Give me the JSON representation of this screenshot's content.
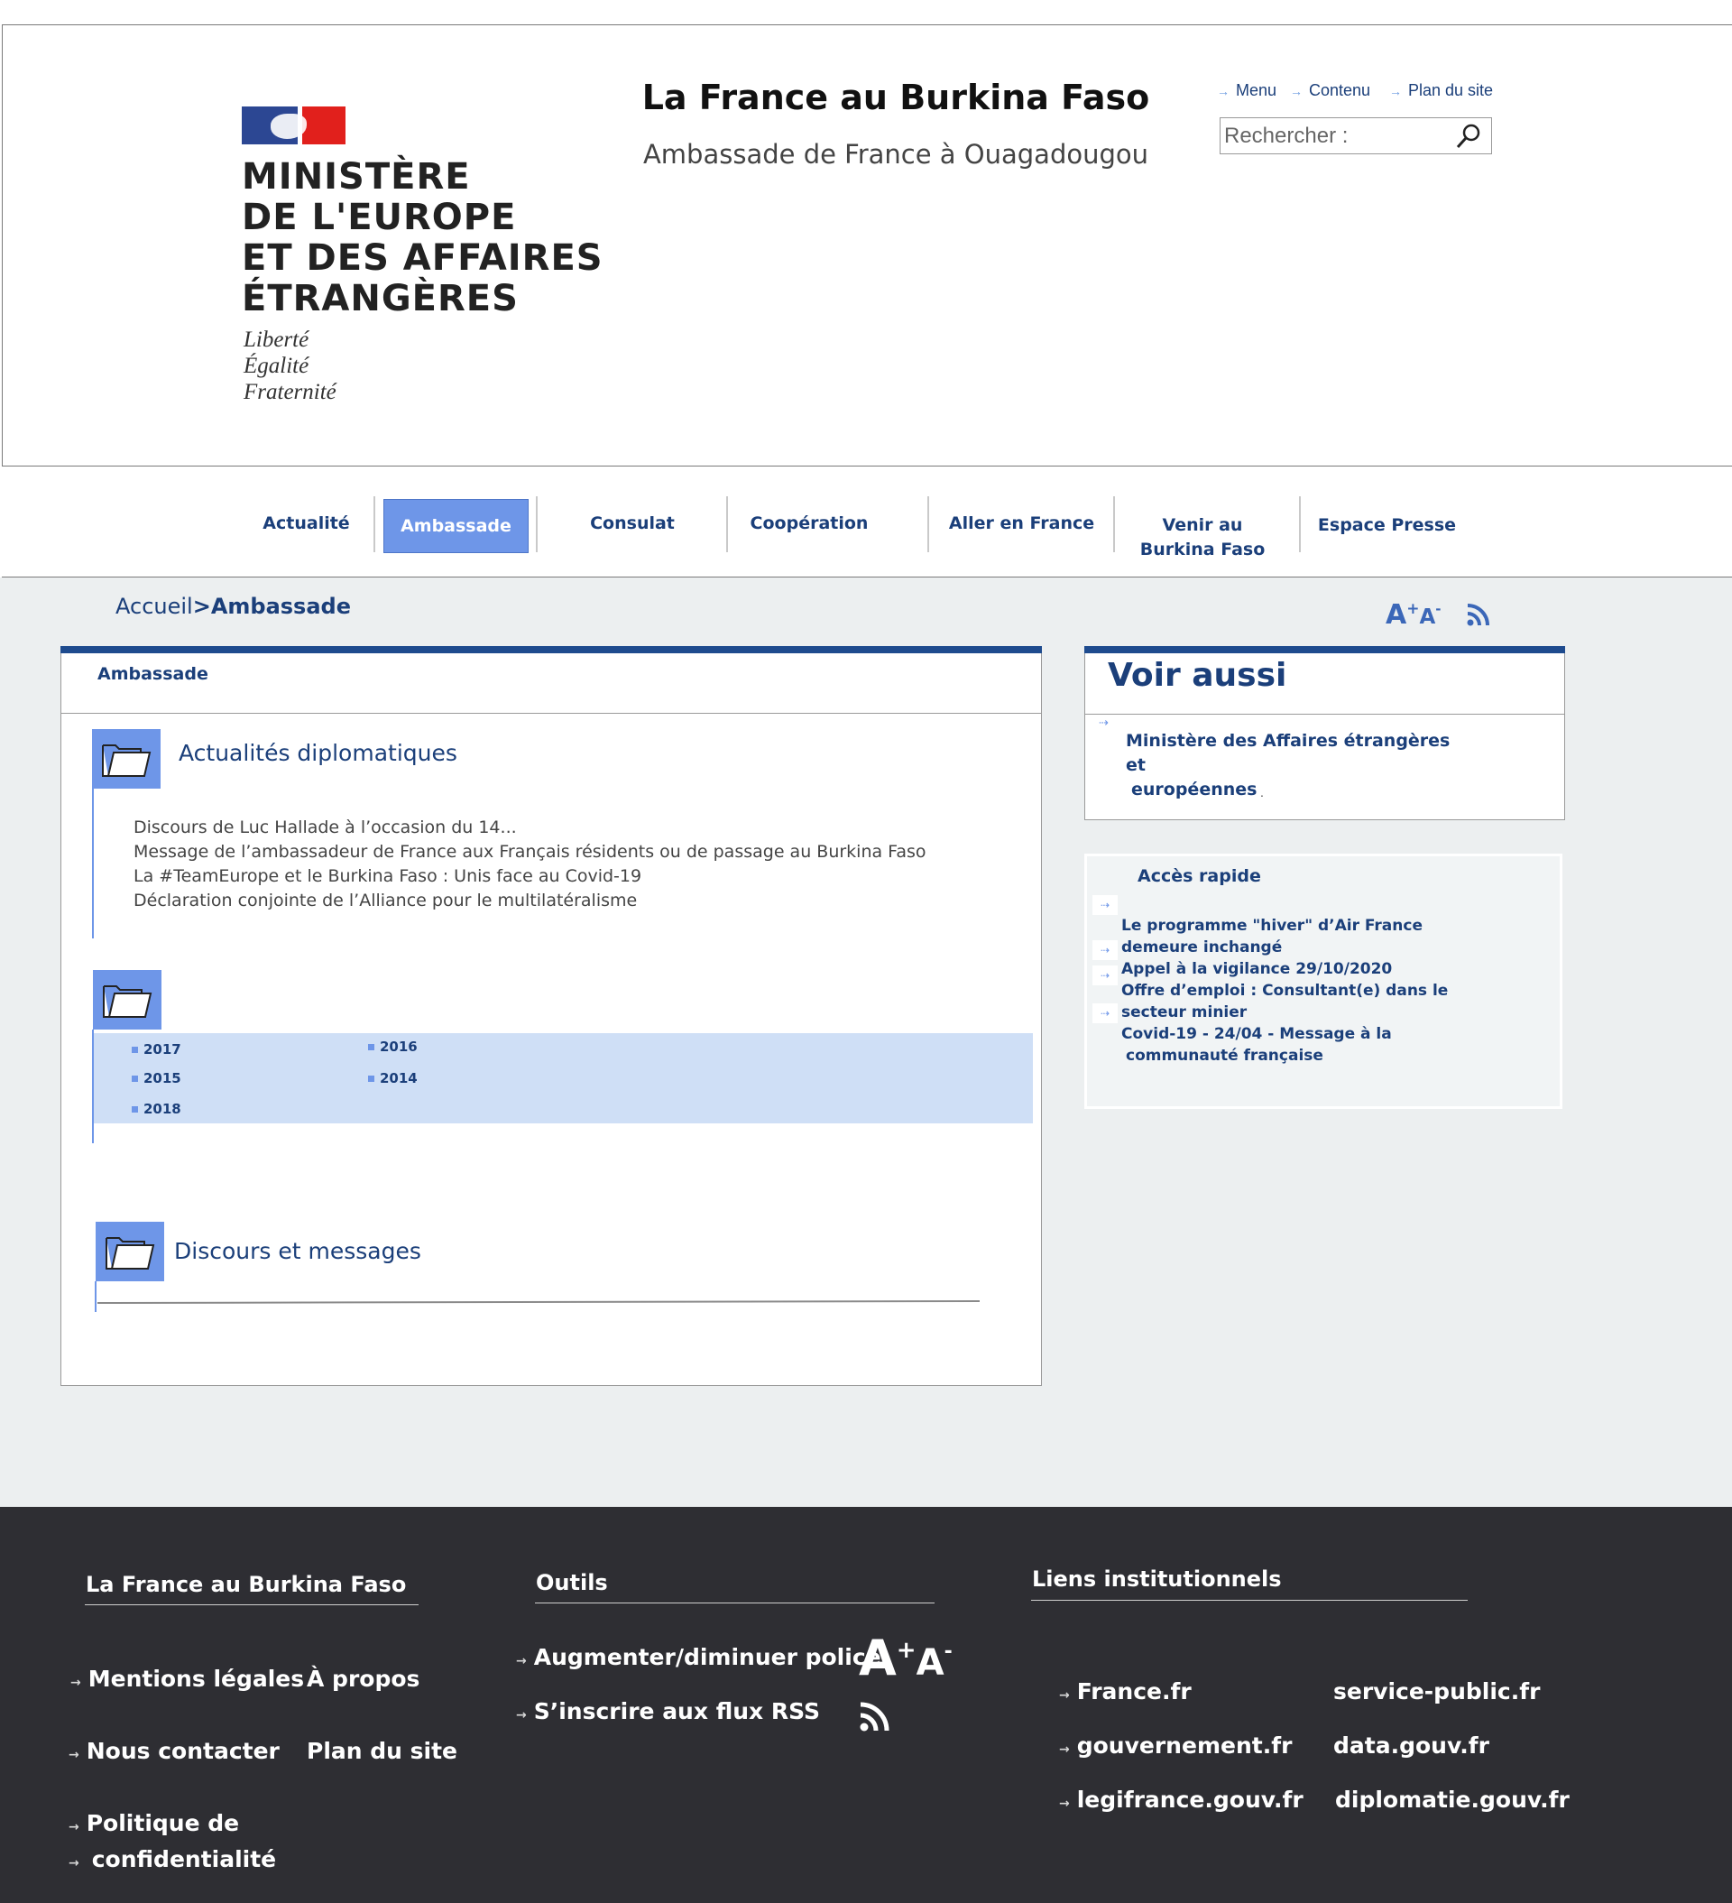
{
  "header": {
    "ministry": "MINISTÈRE\nDE L'EUROPE\nET DES AFFAIRES\nÉTRANGÈRES",
    "motto": "Liberté\nÉgalité\nFraternité",
    "title": "La France au Burkina Faso",
    "subtitle": "Ambassade de France à Ouagadougou",
    "links": [
      "Menu",
      "Contenu",
      "Plan du site"
    ],
    "search_placeholder": "Rechercher :"
  },
  "nav": {
    "items": [
      "Actualité",
      "Ambassade",
      "Consulat",
      "Coopération",
      "Aller en France",
      "Venir au Burkina Faso",
      "Espace Presse"
    ],
    "active": "Ambassade"
  },
  "breadcrumb": {
    "home": "Accueil",
    "sep": ">",
    "current": "Ambassade"
  },
  "tools": {
    "font_size": "A+A-",
    "rss": "rss-icon"
  },
  "main": {
    "heading": "Ambassade",
    "sections": [
      {
        "title": "Actualités diplomatiques",
        "items": [
          "Discours de Luc Hallade à l’occasion du 14...",
          "Message de l’ambassadeur de France aux Français résidents ou de passage au Burkina Faso",
          "La #TeamEurope et le Burkina Faso : Unis face au Covid-19",
          "Déclaration conjointe de l’Alliance pour le multilatéralisme"
        ]
      },
      {
        "title": "",
        "years": [
          "2017",
          "2016",
          "2015",
          "2014",
          "2018"
        ]
      },
      {
        "title": "Discours et messages"
      }
    ]
  },
  "voir_aussi": {
    "title": "Voir aussi",
    "link_line1": "Ministère des Affaires étrangères et",
    "link_line2": "européennes",
    "dot": "."
  },
  "acces_rapide": {
    "title": "Accès rapide",
    "lines": [
      "Le programme \"hiver\" d’Air France",
      "demeure inchangé",
      "Appel à la vigilance 29/10/2020",
      "Offre d’emploi : Consultant(e) dans le",
      "secteur minier",
      "Covid-19 - 24/04 - Message à la",
      "communauté française"
    ]
  },
  "footer": {
    "col1": {
      "title": "La France au Burkina Faso",
      "links": [
        "Mentions légales",
        "À propos",
        "Nous contacter",
        "Plan du site",
        "Politique de",
        "confidentialité"
      ]
    },
    "col2": {
      "title": "Outils",
      "links": [
        "Augmenter/diminuer police",
        "S’inscrire aux flux RSS"
      ],
      "aa": "A+A-"
    },
    "col3": {
      "title": "Liens institutionnels",
      "links": [
        "France.fr",
        "service-public.fr",
        "gouvernement.fr",
        "data.gouv.fr",
        "legifrance.gouv.fr",
        "diplomatie.gouv.fr"
      ]
    }
  },
  "colors": {
    "brand_blue": "#1b3f7a",
    "accent": "#6e96e8",
    "band": "#eceff0",
    "footer": "#2e2e33"
  }
}
